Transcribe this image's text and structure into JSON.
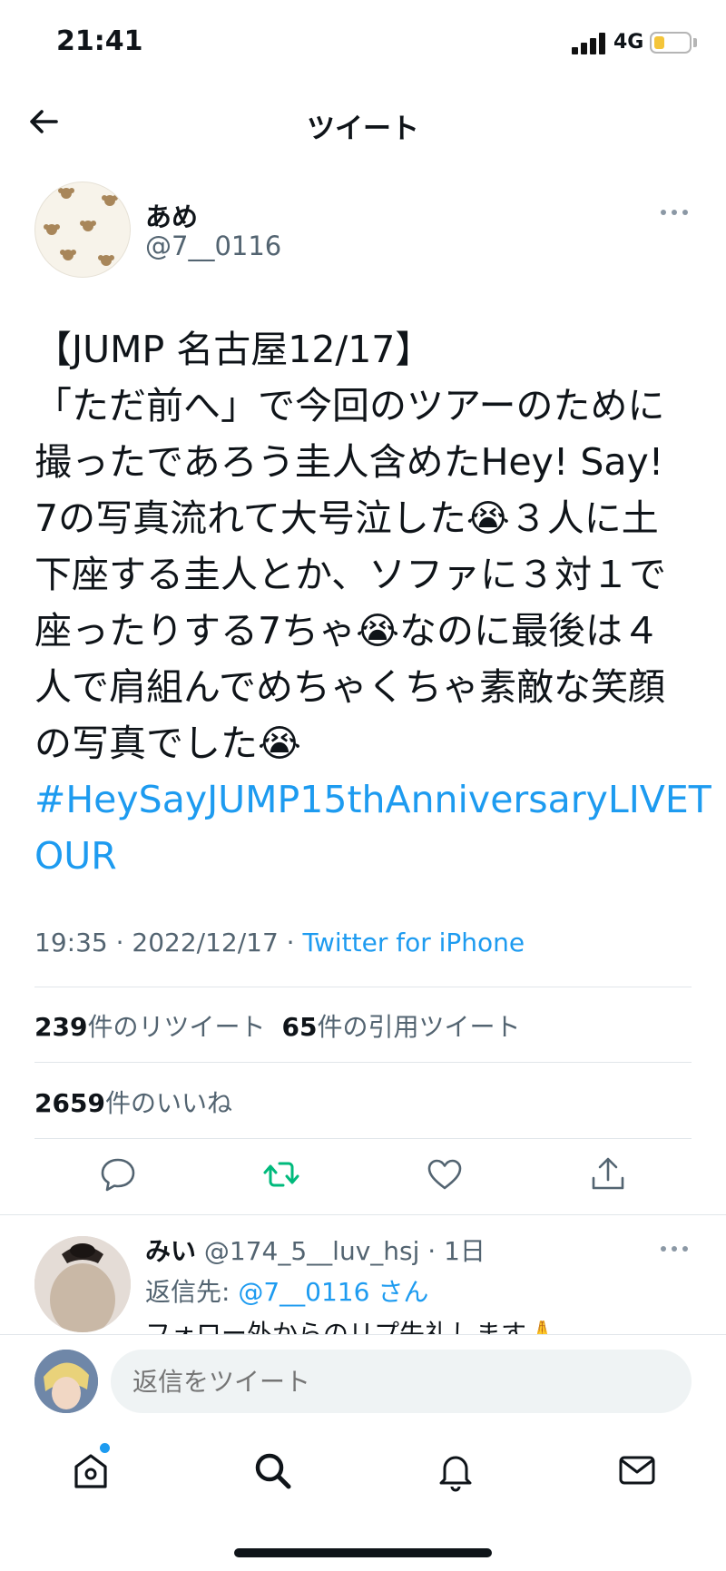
{
  "status_bar": {
    "time": "21:41",
    "network": "4G",
    "battery_level": 0.3
  },
  "header": {
    "title": "ツイート"
  },
  "tweet": {
    "author_name": "あめ",
    "author_handle": "@7__0116",
    "text_lines": [
      "【JUMP 名古屋12/17】",
      "「ただ前へ」で今回のツアーのために",
      "撮ったであろう圭人含めたHey! Say!",
      "7の写真流れて大号泣した😭３人に土",
      "下座する圭人とか、ソファに３対１で",
      "座ったりする7ちゃ😭なのに最後は４",
      "人で肩組んでめちゃくちゃ素敵な笑顔",
      "の写真でした😭"
    ],
    "hashtag_lines": [
      "#HeySayJUMP15thAnniversaryLIVET",
      "OUR"
    ],
    "time": "19:35 · 2022/12/17 · ",
    "source": "Twitter for iPhone",
    "retweets_count": "239",
    "retweets_label": "件のリツイート",
    "quotes_count": "65",
    "quotes_label": "件の引用ツイート",
    "likes_count": "2659",
    "likes_label": "件のいいね"
  },
  "actions": {
    "reply_icon": "comment-icon",
    "retweet_icon": "retweet-icon",
    "like_icon": "heart-icon",
    "share_icon": "share-icon",
    "retweet_color": "#00ba7c"
  },
  "reply": {
    "name": "みい",
    "handle_time": "@174_5__luv_hsj · 1日",
    "reply_to_label": "返信先: ",
    "reply_to_mention": "@7__0116 さん",
    "text": "フォロー外からのリプ失礼します🙏"
  },
  "compose": {
    "placeholder": "返信をツイート"
  },
  "tabbar": {
    "items": [
      "home-icon",
      "search-icon",
      "notifications-icon",
      "messages-icon"
    ]
  },
  "colors": {
    "accent": "#1d9bf0",
    "text": "#0f1419",
    "secondary": "#536471"
  }
}
